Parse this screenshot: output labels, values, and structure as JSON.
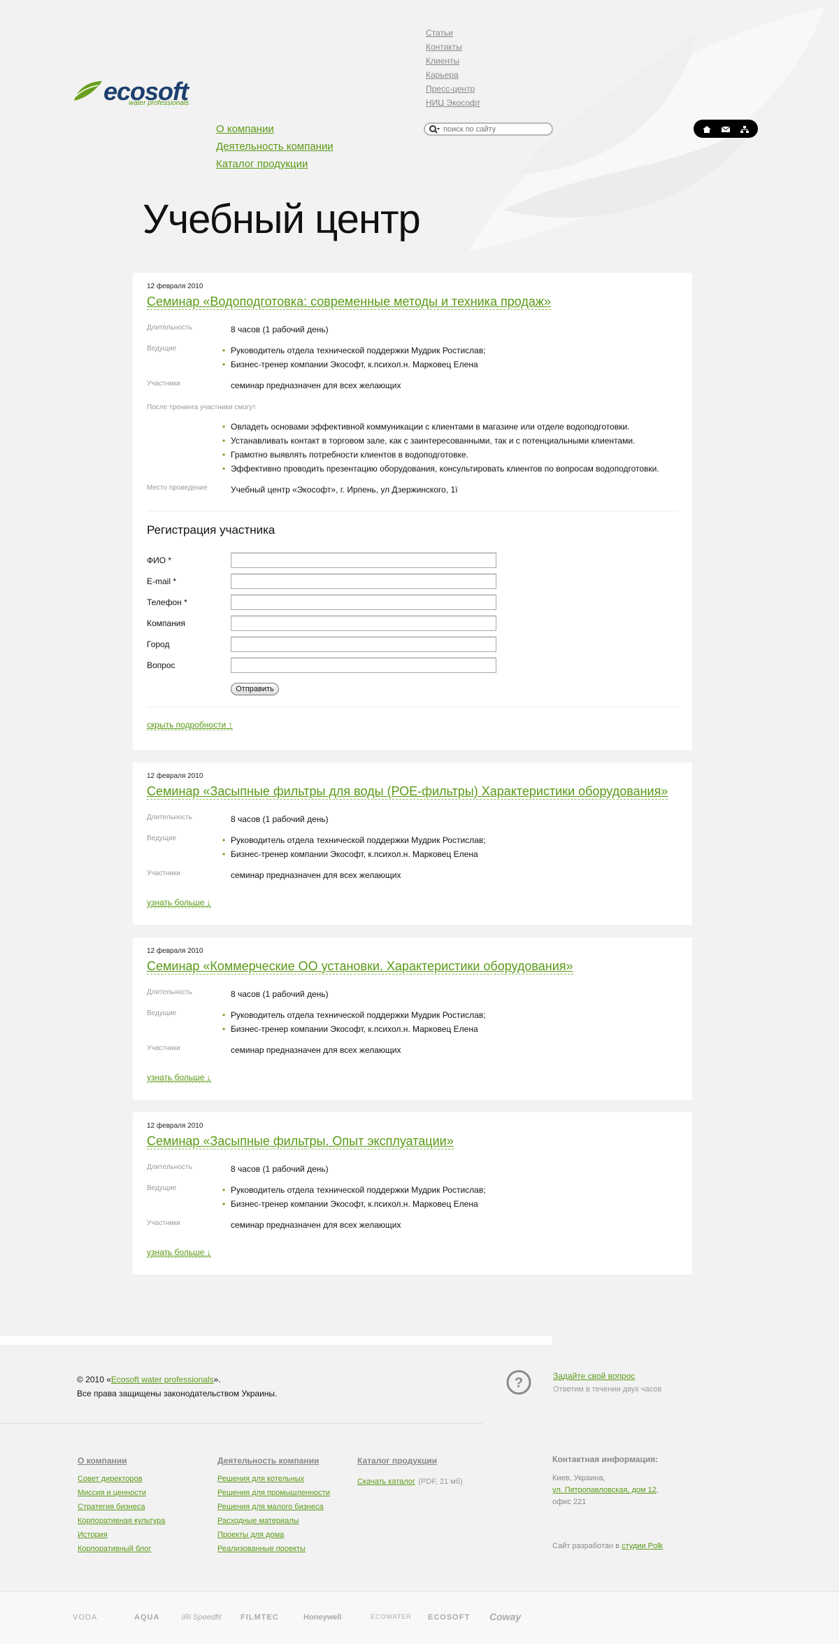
{
  "header": {
    "logo_word": "ecosoft",
    "logo_sub": "water professionals",
    "top_links": [
      "Статьи",
      "Контакты",
      "Клиенты",
      "Карьера",
      "Пресс-центр",
      "НИЦ Экософт"
    ],
    "main_nav": [
      "О компании",
      "Деятельность компании",
      "Каталог продукции"
    ],
    "search_placeholder": "поиск по сайту"
  },
  "page_title": "Учебный центр",
  "seminars": [
    {
      "date": "12 февраля 2010",
      "title": "Семинар «Водоподготовка: современные методы и техника продаж»",
      "duration_label": "Длительность",
      "duration": "8 часов (1 рабочий день)",
      "hosts_label": "Ведущие",
      "hosts": [
        "Руководитель отдела технической поддержки Мудрик Ростислав;",
        "Бизнес-тренер компании Экософт, к.психол.н. Марковец Елена"
      ],
      "participants_label": "Участники",
      "participants": "семинар предназначен для всех желающих",
      "after_label": "После тренинга участники смогут",
      "after": [
        "Овладеть основами эффективной коммуникации с клиентами в магазине или отделе водоподготовки.",
        "Устанавливать контакт в торговом зале, как с заинтересованными, так и с потенциальными клиентами.",
        "Грамотно выявлять потребности клиентов в водоподготовке.",
        "Эффективно проводить презентацию оборудования, консультировать клиентов по вопросам водоподготовки."
      ],
      "place_label": "Место проведение",
      "place": "Учебный центр «Экософт», г. Ирпень, ул Дзержинского, 1ї",
      "form": {
        "heading": "Регистрация участника",
        "fields": [
          "ФИО *",
          "E-mail *",
          "Телефон *",
          "Компания",
          "Город",
          "Вопрос"
        ],
        "submit": "Отправить"
      },
      "toggle": "скрыть подробности ↑"
    },
    {
      "date": "12 февраля 2010",
      "title": "Семинар «Засыпные фильтры для воды (РОЕ-фильтры) Характеристики оборудования»",
      "duration_label": "Длительность",
      "duration": "8 часов (1 рабочий день)",
      "hosts_label": "Ведущие",
      "hosts": [
        "Руководитель отдела технической поддержки Мудрик Ростислав;",
        "Бизнес-тренер компании Экософт, к.психол.н. Марковец Елена"
      ],
      "participants_label": "Участники",
      "participants": "семинар предназначен для всех желающих",
      "toggle": "узнать больше ↓"
    },
    {
      "date": "12 февраля 2010",
      "title": "Семинар «Коммерческие ОО установки. Характеристики оборудования»",
      "duration_label": "Длительность",
      "duration": "8 часов (1 рабочий день)",
      "hosts_label": "Ведущие",
      "hosts": [
        "Руководитель отдела технической поддержки Мудрик Ростислав;",
        "Бизнес-тренер компании Экософт, к.психол.н. Марковец Елена"
      ],
      "participants_label": "Участники",
      "participants": "семинар предназначен для всех желающих",
      "toggle": "узнать больше ↓"
    },
    {
      "date": "12 февраля 2010",
      "title": "Семинар «Засыпные фильтры. Опыт эксплуатации»",
      "duration_label": "Длительность",
      "duration": "8 часов (1 рабочий день)",
      "hosts_label": "Ведущие",
      "hosts": [
        "Руководитель отдела технической поддержки Мудрик Ростислав;",
        "Бизнес-тренер компании Экософт, к.психол.н. Марковец Елена"
      ],
      "participants_label": "Участники",
      "participants": "семинар предназначен для всех желающих",
      "toggle": "узнать больше ↓"
    }
  ],
  "footer": {
    "copy_prefix": "© 2010 «",
    "copy_link": "Ecosoft water professionals",
    "copy_suffix": "».",
    "rights": "Все права защищены законодательством Украины.",
    "ask_link": "Задайте свой вопрос",
    "ask_note": "Ответим в течении двух часов",
    "col1": {
      "heading": "О компании",
      "links": [
        "Совет директоров",
        "Миссия и ценности",
        "Стратегия бизнеса",
        "Корпоративная культура",
        "История",
        "Корпоративный блог"
      ]
    },
    "col2": {
      "heading": "Деятельность компании",
      "links": [
        "Решения для котельных",
        "Решения для промышленности",
        "Решения для малого бизнеса",
        "Расходные материалы",
        "Проекты для дома",
        "Реализованные проекты"
      ]
    },
    "col3": {
      "heading": "Каталог продукции",
      "link": "Скачать каталог",
      "size": "(PDF, 21 мб)"
    },
    "contact": {
      "heading": "Контактная информация:",
      "city": "Киев, Украина,",
      "street": "ул. Петропавловская, дом 12",
      "office": "офис 221"
    },
    "studio_prefix": "Сайт разработан в ",
    "studio_link": "студии Polk",
    "brands": [
      "VODA",
      "AQUA",
      "iRi Speedfit",
      "FILMTEC",
      "Honeywell",
      "ECOWATER",
      "ECOSOFT",
      "Coway"
    ]
  },
  "colors": {
    "accent": "#5b9a17",
    "logo_blue": "#1c3f6e",
    "page_bg": "#f2f2f2"
  }
}
